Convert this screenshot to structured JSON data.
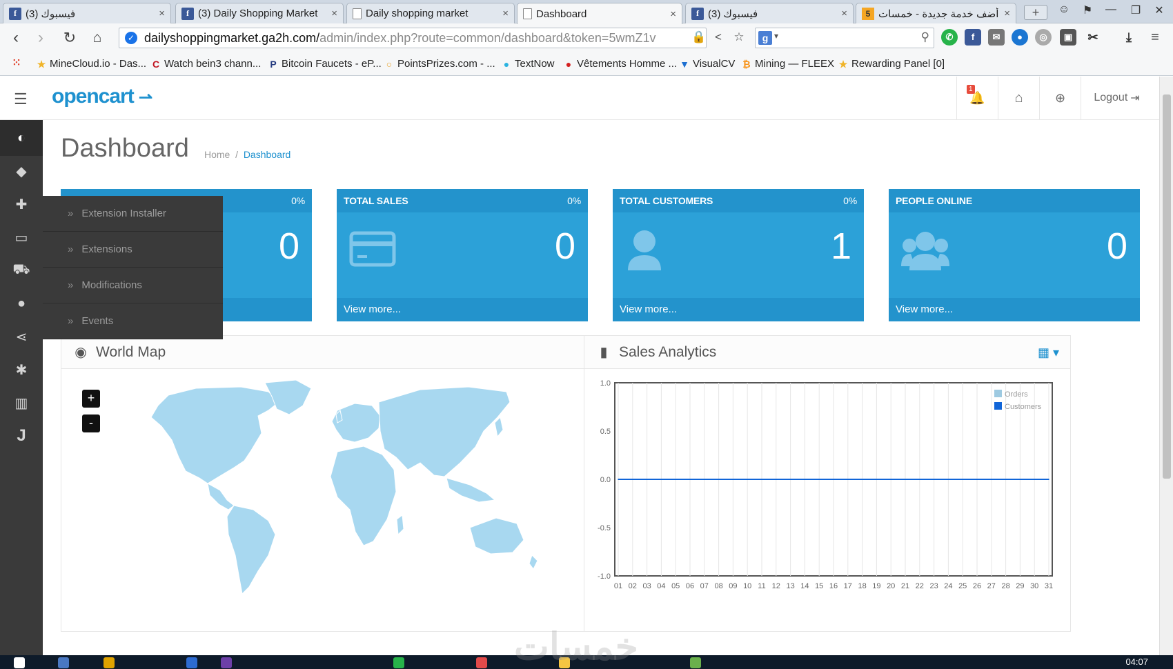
{
  "browser": {
    "tabs": [
      {
        "label": "(3) فيسبوك",
        "icon": "facebook-icon",
        "left": 4,
        "width": 244
      },
      {
        "label": "(3) Daily Shopping Market",
        "icon": "facebook-icon",
        "left": 254,
        "width": 244
      },
      {
        "label": "Daily shopping market",
        "icon": "page-icon",
        "left": 502,
        "width": 244
      },
      {
        "label": "Dashboard",
        "icon": "page-icon",
        "left": 749,
        "width": 240,
        "active": true
      },
      {
        "label": "(3) فيسبوك",
        "icon": "facebook-icon",
        "left": 993,
        "width": 244
      },
      {
        "label": "أضف خدمة جديدة - خمسات",
        "icon": "khamsat-icon",
        "left": 1240,
        "width": 233
      }
    ],
    "new_tab": "+",
    "url_domain": "dailyshoppingmarket.ga2h.com/",
    "url_path": "admin/index.php?route=common/dashboard&token=5wmZ1v",
    "search_engine": "g",
    "bookmarks": [
      {
        "label": "MineCloud.io - Das...",
        "icon": "star-icon",
        "color": "#f0b429",
        "glyph": "★"
      },
      {
        "label": "Watch bein3 chann...",
        "icon": "c-logo-icon",
        "color": "#c0121e",
        "glyph": "C"
      },
      {
        "label": "Bitcoin Faucets - eP...",
        "icon": "paypal-icon",
        "color": "#253b80",
        "glyph": "P"
      },
      {
        "label": "PointsPrizes.com - ...",
        "icon": "ring-icon",
        "color": "#e8a530",
        "glyph": "○"
      },
      {
        "label": "TextNow",
        "icon": "chat-icon",
        "color": "#2bb3e0",
        "glyph": "●"
      },
      {
        "label": "Vêtements Homme ...",
        "icon": "tag-icon",
        "color": "#d42020",
        "glyph": "●"
      },
      {
        "label": "VisualCV",
        "icon": "filter-icon",
        "color": "#1d6fd1",
        "glyph": "▼"
      },
      {
        "label": "Mining — FLEEX",
        "icon": "bitcoin-icon",
        "color": "#f7931a",
        "glyph": "₿"
      },
      {
        "label": "Rewarding Panel [0]",
        "icon": "star-icon",
        "color": "#f0b429",
        "glyph": "★"
      }
    ]
  },
  "header": {
    "logo_text": "opencart",
    "notification_count": "1",
    "logout_label": "Logout"
  },
  "sidebar": {
    "icons": [
      "dashboard-icon",
      "tags-icon",
      "puzzle-icon",
      "desktop-icon",
      "cart-icon",
      "user-icon",
      "share-icon",
      "cog-icon",
      "bar-chart-icon",
      "j-icon"
    ],
    "flyout": [
      "Extension Installer",
      "Extensions",
      "Modifications",
      "Events"
    ]
  },
  "page": {
    "title": "Dashboard",
    "breadcrumb_home": "Home",
    "breadcrumb_sep": "/",
    "breadcrumb_current": "Dashboard"
  },
  "tiles": [
    {
      "title": "",
      "pct": "0%",
      "value": "0",
      "link": "",
      "icon": "none-icon"
    },
    {
      "title": "TOTAL SALES",
      "pct": "0%",
      "value": "0",
      "link": "View more...",
      "icon": "credit-card-icon"
    },
    {
      "title": "TOTAL CUSTOMERS",
      "pct": "0%",
      "value": "1",
      "link": "View more...",
      "icon": "user-icon"
    },
    {
      "title": "PEOPLE ONLINE",
      "pct": "",
      "value": "0",
      "link": "View more...",
      "icon": "users-icon"
    }
  ],
  "world_map": {
    "title": "World Map",
    "zoom_in": "+",
    "zoom_out": "-"
  },
  "sales_analytics": {
    "title": "Sales Analytics"
  },
  "chart_data": {
    "type": "line",
    "title": "Sales Analytics",
    "x": [
      "01",
      "02",
      "03",
      "04",
      "05",
      "06",
      "07",
      "08",
      "09",
      "10",
      "11",
      "12",
      "13",
      "14",
      "15",
      "16",
      "17",
      "18",
      "19",
      "20",
      "21",
      "22",
      "23",
      "24",
      "25",
      "26",
      "27",
      "28",
      "29",
      "30",
      "31"
    ],
    "series": [
      {
        "name": "Orders",
        "color": "#9ecae1",
        "values": [
          0,
          0,
          0,
          0,
          0,
          0,
          0,
          0,
          0,
          0,
          0,
          0,
          0,
          0,
          0,
          0,
          0,
          0,
          0,
          0,
          0,
          0,
          0,
          0,
          0,
          0,
          0,
          0,
          0,
          0,
          0
        ]
      },
      {
        "name": "Customers",
        "color": "#1065d8",
        "values": [
          0,
          0,
          0,
          0,
          0,
          0,
          0,
          0,
          0,
          0,
          0,
          0,
          0,
          0,
          0,
          0,
          0,
          0,
          0,
          0,
          0,
          0,
          0,
          0,
          0,
          0,
          0,
          0,
          0,
          0,
          0
        ]
      }
    ],
    "ylim": [
      -1.0,
      1.0
    ],
    "yticks": [
      "1.0",
      "0.5",
      "0.0",
      "-0.5",
      "-1.0"
    ],
    "grid": true,
    "legend": "top-right"
  },
  "taskbar": {
    "clock": "04:07"
  },
  "watermark": "خمسات"
}
